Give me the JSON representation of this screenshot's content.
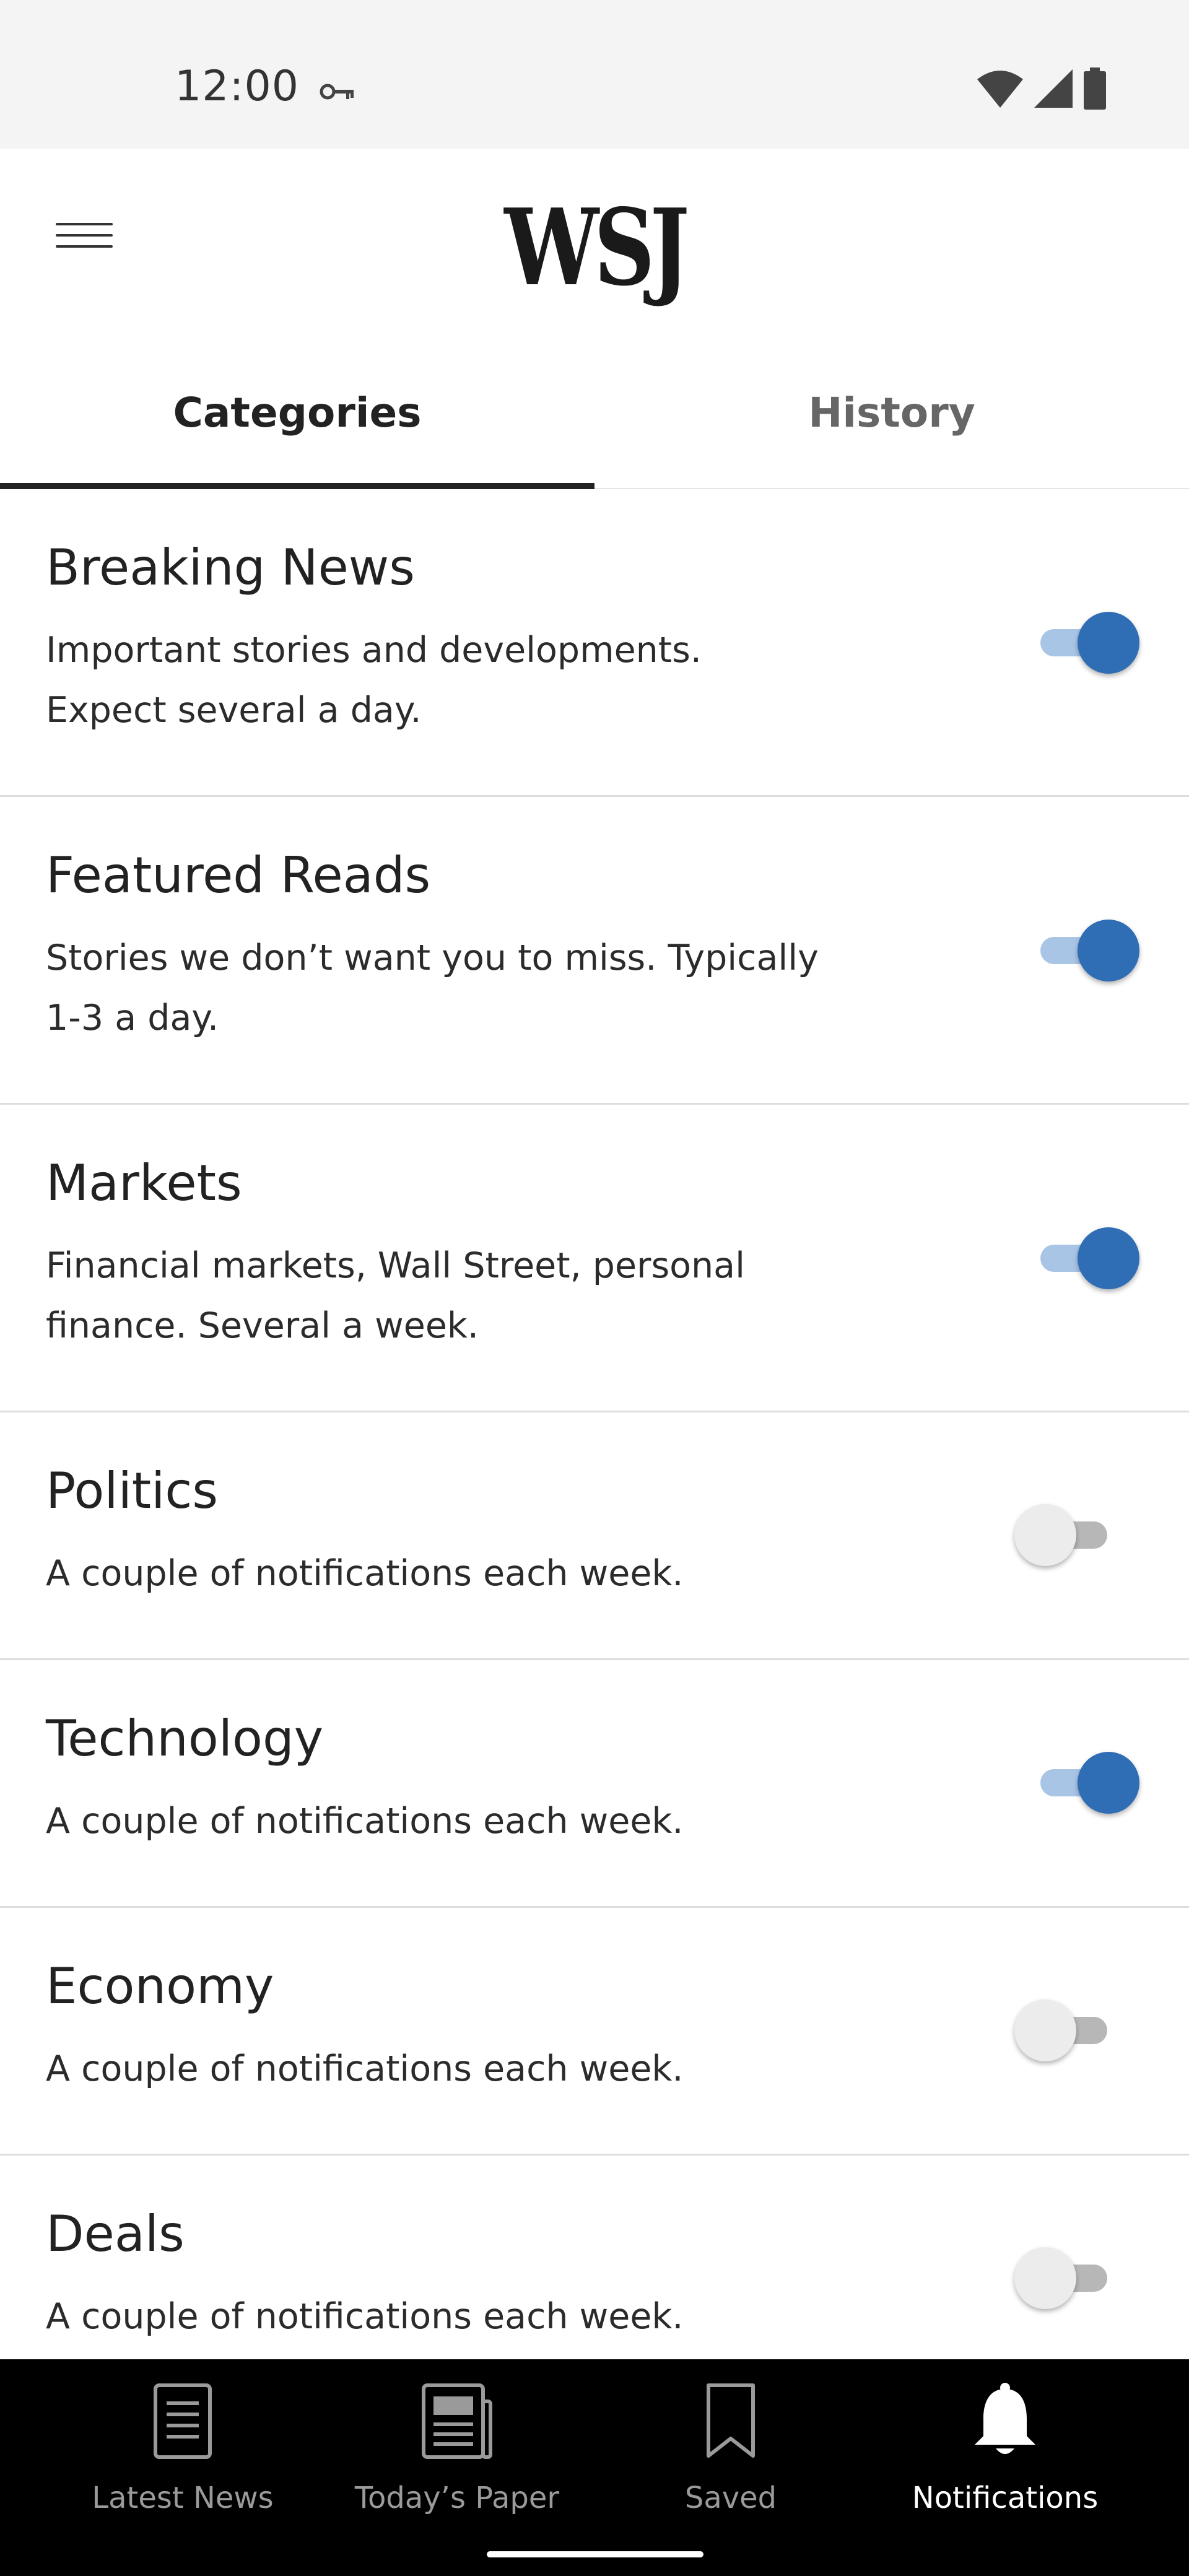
{
  "status_bar": {
    "time": "12:00",
    "icons": [
      "vpn-key-icon",
      "wifi-icon",
      "signal-icon",
      "battery-icon"
    ]
  },
  "app_bar": {
    "logo": "WSJ",
    "menu_icon": "hamburger-menu-icon"
  },
  "tabs": [
    {
      "label": "Categories",
      "active": true
    },
    {
      "label": "History",
      "active": false
    }
  ],
  "categories": [
    {
      "title": "Breaking News",
      "description": "Important stories and developments. Expect several a day.",
      "enabled": true
    },
    {
      "title": "Featured Reads",
      "description": "Stories we don’t want you to miss. Typically 1-3 a day.",
      "enabled": true
    },
    {
      "title": "Markets",
      "description": "Financial markets, Wall Street, personal finance. Several a week.",
      "enabled": true
    },
    {
      "title": "Politics",
      "description": "A couple of notifications each week.",
      "enabled": false
    },
    {
      "title": "Technology",
      "description": "A couple of notifications each week.",
      "enabled": true
    },
    {
      "title": "Economy",
      "description": "A couple of notifications each week.",
      "enabled": false
    },
    {
      "title": "Deals",
      "description": "A couple of notifications each week.",
      "enabled": false
    }
  ],
  "bottom_nav": [
    {
      "label": "Latest News",
      "icon": "document-icon",
      "active": false
    },
    {
      "label": "Today’s Paper",
      "icon": "newspaper-icon",
      "active": false
    },
    {
      "label": "Saved",
      "icon": "bookmark-icon",
      "active": false
    },
    {
      "label": "Notifications",
      "icon": "bell-icon",
      "active": true
    }
  ],
  "colors": {
    "toggle_on_thumb": "#2f6db5",
    "toggle_on_track": "#a9c5e6",
    "toggle_off_thumb": "#ececec",
    "toggle_off_track": "#b7b7b7",
    "nav_background": "#000000"
  }
}
